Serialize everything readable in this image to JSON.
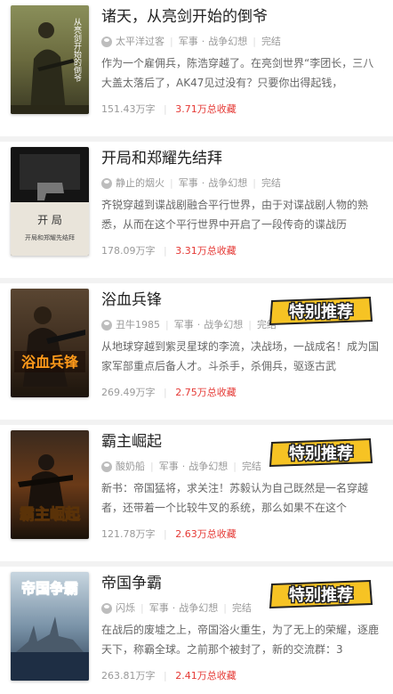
{
  "books": [
    {
      "title": "诸天，从亮剑开始的倒爷",
      "author": "太平洋过客",
      "category": "军事",
      "subcategory": "战争幻想",
      "status": "完结",
      "description": "作为一个雇佣兵，陈浩穿越了。在亮剑世界“李团长，三八大盖太落后了，AK47见过没有？只要你出得起钱，",
      "word_count": "151.43万字",
      "favorites": "3.71万总收藏",
      "cover_text": "从亮剑开始的倒爷",
      "special": false
    },
    {
      "title": "开局和郑耀先结拜",
      "author": "静止的烟火",
      "category": "军事",
      "subcategory": "战争幻想",
      "status": "完结",
      "description": "齐锐穿越到谍战剧融合平行世界，由于对谍战剧人物的熟悉，从而在这个平行世界中开启了一段传奇的谍战历",
      "word_count": "178.09万字",
      "favorites": "3.31万总收藏",
      "cover_text": "开局和郑耀先结拜",
      "special": false
    },
    {
      "title": "浴血兵锋",
      "author": "丑牛1985",
      "category": "军事",
      "subcategory": "战争幻想",
      "status": "完结",
      "description": "从地球穿越到紫灵星球的李流，决战场，一战成名！成为国家军部重点后备人才。斗杀手，杀佣兵，驱逐古武",
      "word_count": "269.49万字",
      "favorites": "2.75万总收藏",
      "cover_text": "浴血兵锋",
      "special": true
    },
    {
      "title": "霸主崛起",
      "author": "酸奶船",
      "category": "军事",
      "subcategory": "战争幻想",
      "status": "完结",
      "description": "新书：帝国猛将，求关注！苏毅认为自己既然是一名穿越者，还带着一个比较牛叉的系统，那么如果不在这个",
      "word_count": "121.78万字",
      "favorites": "2.63万总收藏",
      "cover_text": "霸主崛起",
      "special": true
    },
    {
      "title": "帝国争霸",
      "author": "闪烁",
      "category": "军事",
      "subcategory": "战争幻想",
      "status": "完结",
      "description": "在战后的废墟之上，帝国浴火重生，为了无上的荣耀，逐鹿天下，称霸全球。之前那个被封了，新的交流群：3",
      "word_count": "263.81万字",
      "favorites": "2.41万总收藏",
      "cover_text": "帝国争霸",
      "special": true
    }
  ],
  "badge_text": "特别推荐",
  "colors": {
    "favorites": "#e53935",
    "badge_fill": "#f6c324",
    "badge_stroke": "#222222"
  }
}
